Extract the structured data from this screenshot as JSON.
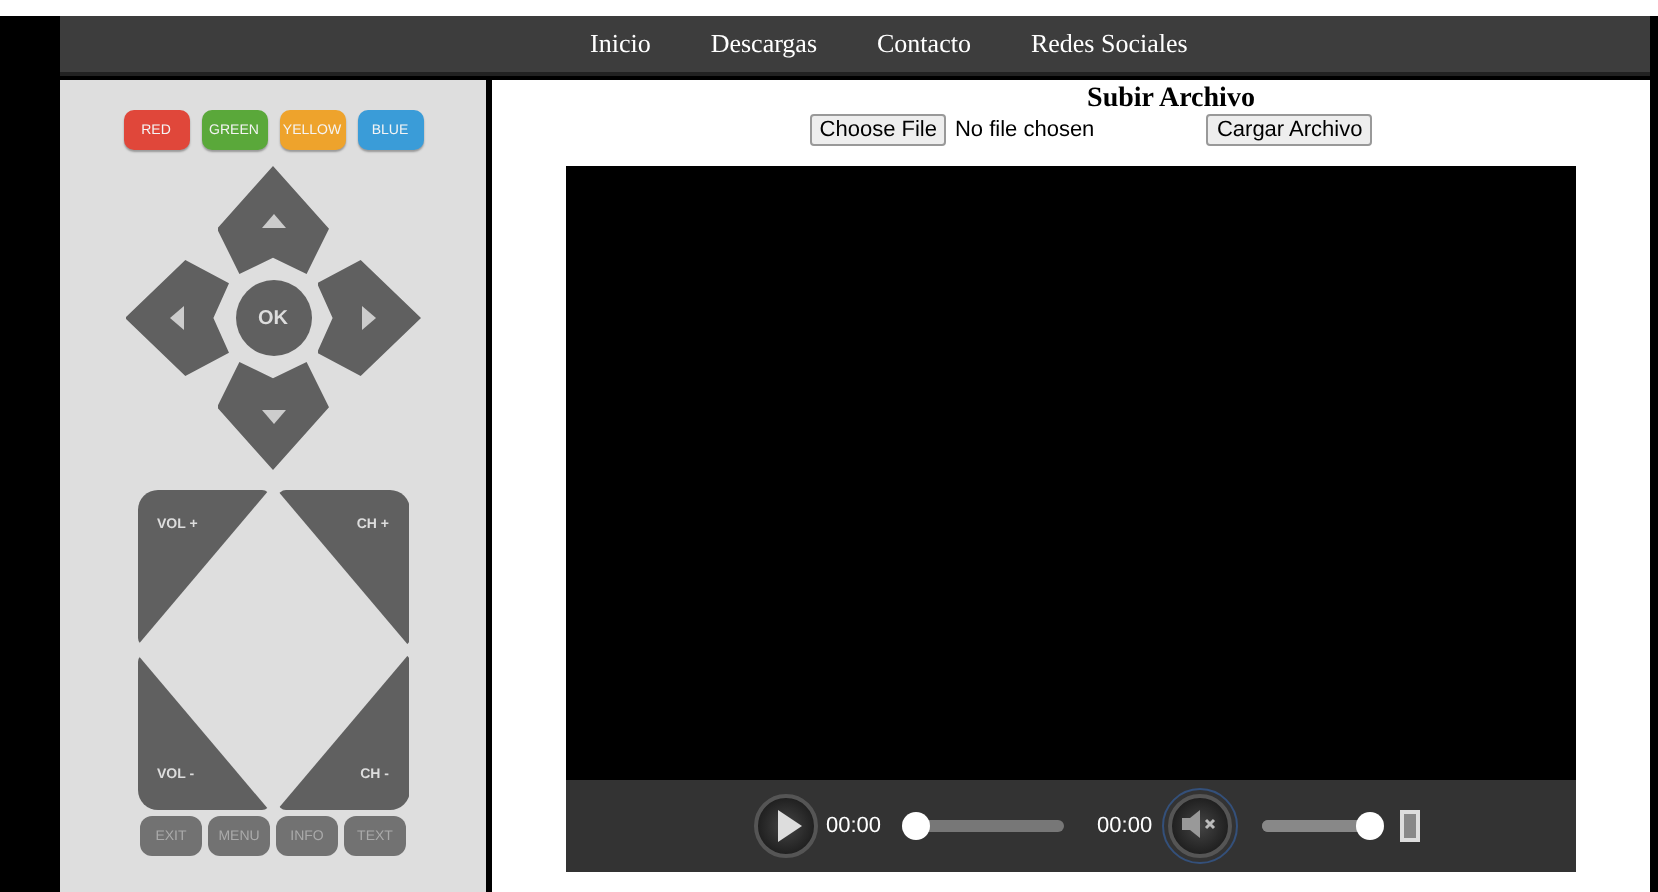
{
  "nav": {
    "items": [
      {
        "label": "Inicio"
      },
      {
        "label": "Descargas"
      },
      {
        "label": "Contacto"
      },
      {
        "label": "Redes Sociales"
      }
    ]
  },
  "remote": {
    "color_buttons": [
      {
        "label": "RED",
        "color": "#e0473a"
      },
      {
        "label": "GREEN",
        "color": "#5aa83a"
      },
      {
        "label": "YELLOW",
        "color": "#eea32c"
      },
      {
        "label": "BLUE",
        "color": "#3a9cd8"
      }
    ],
    "ok": "OK",
    "rockers": [
      {
        "kind": "tl",
        "label": "VOL +"
      },
      {
        "kind": "tr",
        "label": "CH +"
      },
      {
        "kind": "bl",
        "label": "VOL -"
      },
      {
        "kind": "br",
        "label": "CH -"
      }
    ],
    "function_buttons": [
      {
        "label": "EXIT"
      },
      {
        "label": "MENU"
      },
      {
        "label": "INFO"
      },
      {
        "label": "TEXT"
      }
    ]
  },
  "upload": {
    "title": "Subir Archivo",
    "choose_button": "Choose File",
    "file_status": "No file chosen",
    "submit_button": "Cargar Archivo"
  },
  "player": {
    "current_time": "00:00",
    "seek": {
      "level": 0
    },
    "duration": "00:00",
    "mute": {
      "muted": true,
      "focused": true
    },
    "volume": {
      "level": 1
    }
  }
}
